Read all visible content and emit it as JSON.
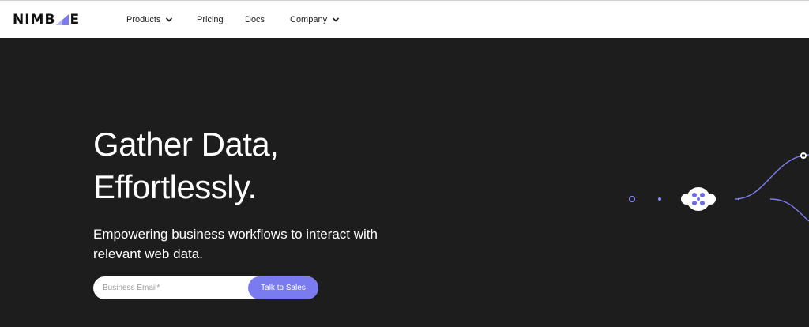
{
  "brand": {
    "name_left": "NIMB",
    "name_right": "E",
    "accent": "#7b7bf0"
  },
  "nav": {
    "items": [
      {
        "label": "Products",
        "has_dropdown": true
      },
      {
        "label": "Pricing",
        "has_dropdown": false
      },
      {
        "label": "Docs",
        "has_dropdown": false
      },
      {
        "label": "Company",
        "has_dropdown": true
      }
    ]
  },
  "hero": {
    "headline_line1": "Gather Data,",
    "headline_line2": "Effortlessly.",
    "subtitle_line1": "Empowering business workflows to interact with",
    "subtitle_line2": "relevant web data.",
    "email_placeholder": "Business Email*",
    "cta_label": "Talk to Sales",
    "background": "#1e1d1e"
  }
}
